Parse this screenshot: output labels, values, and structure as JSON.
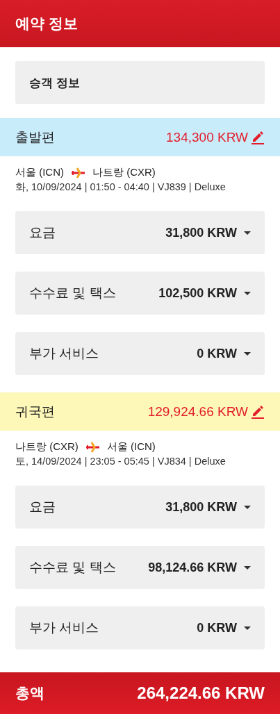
{
  "header": {
    "title": "예약 정보"
  },
  "passenger": {
    "label": "승객 정보"
  },
  "flights": [
    {
      "title": "출발편",
      "color": "#c9ecfb",
      "amount": "134,300 KRW",
      "origin": "서울 (ICN)",
      "destination": "나트랑 (CXR)",
      "details": "화, 10/09/2024 | 01:50 - 04:40 | VJ839 | Deluxe",
      "fees": [
        {
          "label": "요금",
          "amount": "31,800 KRW"
        },
        {
          "label": "수수료 및 택스",
          "amount": "102,500 KRW"
        },
        {
          "label": "부가 서비스",
          "amount": "0 KRW"
        }
      ]
    },
    {
      "title": "귀국편",
      "color": "#fdf8b8",
      "amount": "129,924.66 KRW",
      "origin": "나트랑 (CXR)",
      "destination": "서울 (ICN)",
      "details": "토, 14/09/2024 | 23:05 - 05:45 | VJ834 | Deluxe",
      "fees": [
        {
          "label": "요금",
          "amount": "31,800 KRW"
        },
        {
          "label": "수수료 및 택스",
          "amount": "98,124.66 KRW"
        },
        {
          "label": "부가 서비스",
          "amount": "0 KRW"
        }
      ]
    }
  ],
  "total": {
    "label": "총액",
    "amount": "264,224.66 KRW"
  }
}
